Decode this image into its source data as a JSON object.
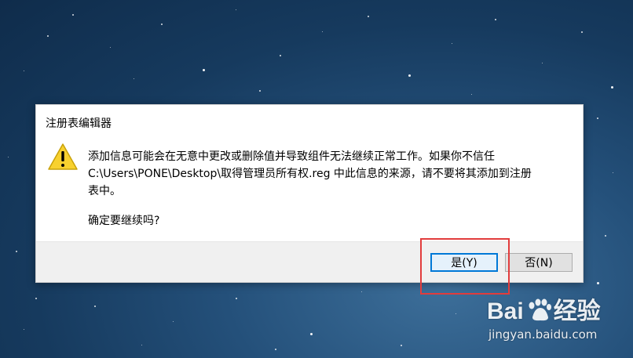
{
  "dialog": {
    "title": "注册表编辑器",
    "message_line1": "添加信息可能会在无意中更改或删除值并导致组件无法继续正常工作。如果你不信任",
    "message_line2": "C:\\Users\\PONE\\Desktop\\取得管理员所有权.reg 中此信息的来源，请不要将其添加到注册",
    "message_line3": "表中。",
    "confirm": "确定要继续吗?",
    "icon": "warning-icon",
    "buttons": {
      "yes": "是(Y)",
      "no": "否(N)"
    }
  },
  "watermark": {
    "logo_left": "Bai",
    "logo_right": "经验",
    "url": "jingyan.baidu.com"
  },
  "colors": {
    "highlight": "#e23c3c",
    "accent": "#0078d7"
  }
}
